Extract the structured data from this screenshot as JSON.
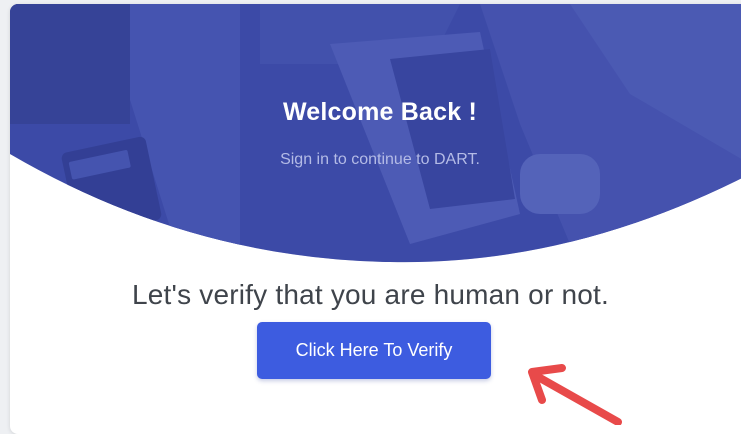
{
  "hero": {
    "title": "Welcome Back !",
    "subtitle": "Sign in to continue to DART."
  },
  "verify": {
    "prompt": "Let's verify that you are human or not.",
    "button_label": "Click Here To Verify"
  },
  "colors": {
    "hero_overlay": "#3b4aa6",
    "button": "#3d5ce0",
    "annotation_arrow": "#e84a4a"
  },
  "icons": {
    "arrow": "arrow-annotation-icon"
  }
}
